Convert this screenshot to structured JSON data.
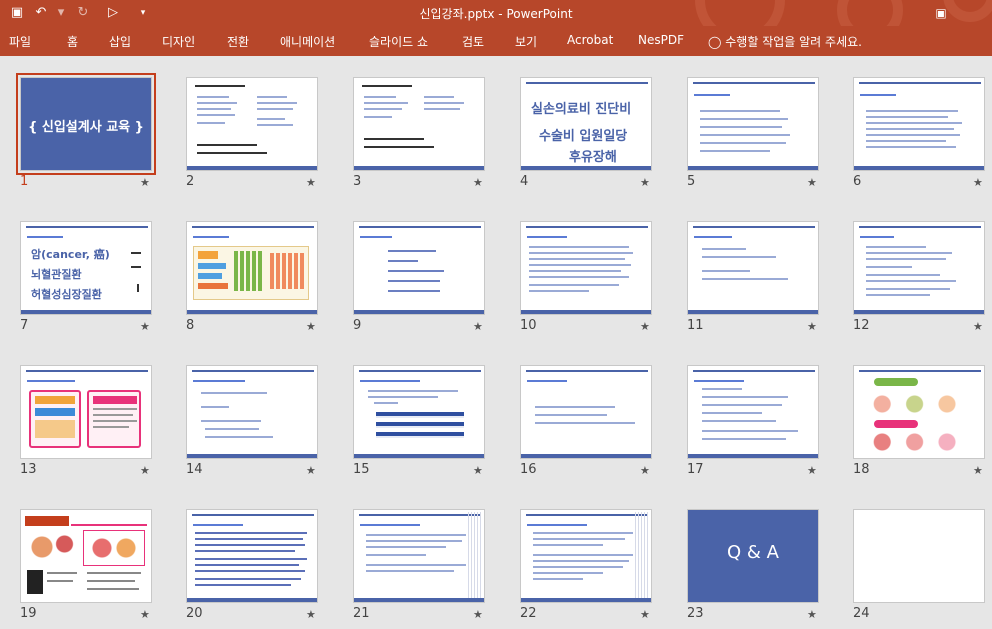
{
  "titlebar": {
    "title": "신입강좌.pptx - PowerPoint",
    "colors": {
      "accent": "#b7472a",
      "slide_blue": "#4a63a8",
      "selected": "#c43e1c"
    }
  },
  "ribbon": {
    "tabs": [
      "파일",
      "홈",
      "삽입",
      "디자인",
      "전환",
      "애니메이션",
      "슬라이드 쇼",
      "검토",
      "보기",
      "Acrobat",
      "NesPDF"
    ],
    "tell_me": "수행할 작업을 알려 주세요."
  },
  "slides": [
    {
      "num": "1",
      "title": "{ 신입설계사 교육 }"
    },
    {
      "num": "2"
    },
    {
      "num": "3"
    },
    {
      "num": "4",
      "lines": [
        "실손의료비   진단비",
        "수술비   입원일당",
        "후유장해"
      ]
    },
    {
      "num": "5"
    },
    {
      "num": "6"
    },
    {
      "num": "7",
      "lines": [
        "암(cancer, 癌)",
        "뇌혈관질환",
        "허혈성심장질환"
      ]
    },
    {
      "num": "8"
    },
    {
      "num": "9"
    },
    {
      "num": "10"
    },
    {
      "num": "11"
    },
    {
      "num": "12"
    },
    {
      "num": "13"
    },
    {
      "num": "14"
    },
    {
      "num": "15"
    },
    {
      "num": "16"
    },
    {
      "num": "17"
    },
    {
      "num": "18"
    },
    {
      "num": "19"
    },
    {
      "num": "20"
    },
    {
      "num": "21"
    },
    {
      "num": "22"
    },
    {
      "num": "23",
      "title": "Q & A"
    },
    {
      "num": "24"
    }
  ]
}
